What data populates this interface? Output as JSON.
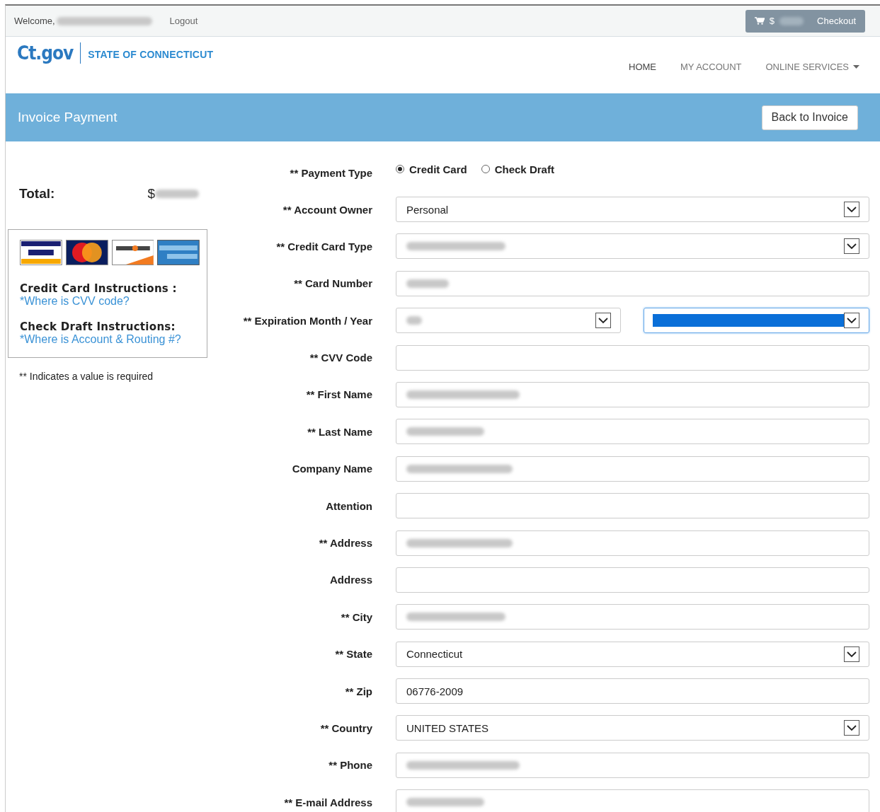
{
  "top_bar": {
    "welcome": "Welcome,",
    "welcome_name_redacted": true,
    "logout": "Logout",
    "cart": {
      "currency": "$",
      "amount_redacted": true,
      "label": "Checkout"
    }
  },
  "header": {
    "logo": "Ct.gov",
    "site_name": "STATE OF CONNECTICUT",
    "nav": [
      {
        "label": "HOME",
        "dropdown": false,
        "selected": true
      },
      {
        "label": "MY ACCOUNT",
        "dropdown": false,
        "selected": false
      },
      {
        "label": "ONLINE SERVICES",
        "dropdown": true,
        "selected": false
      }
    ]
  },
  "banner": {
    "title": "Invoice Payment",
    "button": "Back to Invoice"
  },
  "sidebar": {
    "total_label": "Total:",
    "total_currency": "$",
    "total_redacted": true,
    "instructions": [
      {
        "heading": "Credit Card Instructions :",
        "link": "*Where is CVV code?"
      },
      {
        "heading": "Check Draft Instructions:",
        "link": "*Where is Account & Routing #?"
      }
    ],
    "note": "** Indicates a value is required"
  },
  "form": [
    {
      "kind": "radio",
      "label": "** Payment Type",
      "options": [
        {
          "label": "Credit Card",
          "selected": true
        },
        {
          "label": "Check Draft",
          "selected": false
        }
      ]
    },
    {
      "kind": "select",
      "label": "** Account Owner",
      "value": "Personal",
      "redacted": false
    },
    {
      "kind": "select",
      "label": "** Credit Card Type",
      "redacted": true
    },
    {
      "kind": "text",
      "label": "** Card Number",
      "redacted": true
    },
    {
      "kind": "pair",
      "label": "** Expiration Month / Year",
      "selects": [
        {
          "redacted": true,
          "focused": false
        },
        {
          "redacted": true,
          "focused": true
        }
      ]
    },
    {
      "kind": "text",
      "label": "** CVV Code",
      "redacted": false
    },
    {
      "kind": "text",
      "label": "** First Name",
      "redacted": true
    },
    {
      "kind": "text",
      "label": "** Last Name",
      "redacted": true
    },
    {
      "kind": "text",
      "label": "Company Name",
      "redacted": true
    },
    {
      "kind": "text",
      "label": "Attention",
      "redacted": false
    },
    {
      "kind": "text",
      "label": "** Address",
      "redacted": true
    },
    {
      "kind": "text",
      "label": "Address",
      "redacted": false
    },
    {
      "kind": "text",
      "label": "** City",
      "redacted": true
    },
    {
      "kind": "select",
      "label": "** State",
      "value": "Connecticut",
      "redacted": false
    },
    {
      "kind": "text",
      "label": "** Zip",
      "value": "06776-2009",
      "redacted": false
    },
    {
      "kind": "select",
      "label": "** Country",
      "value": "UNITED STATES",
      "redacted": false
    },
    {
      "kind": "text",
      "label": "** Phone",
      "redacted": true
    },
    {
      "kind": "text",
      "label": "** E-mail Address",
      "redacted": true
    }
  ]
}
